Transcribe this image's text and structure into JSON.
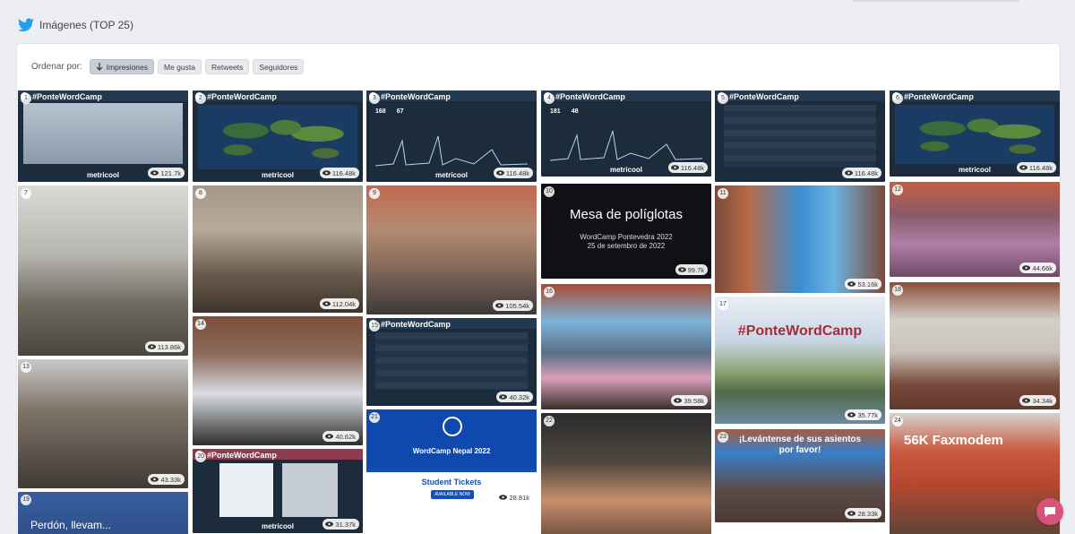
{
  "header": {
    "title": "Imágenes (TOP 25)",
    "icon": "twitter-icon"
  },
  "sort": {
    "label": "Ordenar por:",
    "options": [
      "Impresiones",
      "Me gusta",
      "Retweets",
      "Seguidores"
    ],
    "active": "Impresiones"
  },
  "brand_tag": "#PonteWordCamp",
  "brand_name": "metricool",
  "tiles": [
    {
      "num": "1",
      "views": "121.7k"
    },
    {
      "num": "2",
      "views": "116.48k"
    },
    {
      "num": "3",
      "views": "116.48k",
      "stats": [
        "168",
        "67"
      ]
    },
    {
      "num": "4",
      "views": "116.48k",
      "stats": [
        "181",
        "48"
      ]
    },
    {
      "num": "5",
      "views": "116.48k"
    },
    {
      "num": "6",
      "views": "116.48k"
    },
    {
      "num": "7",
      "views": "113.86k"
    },
    {
      "num": "8",
      "views": "112.04k"
    },
    {
      "num": "9",
      "views": "105.54k"
    },
    {
      "num": "10",
      "views": "99.7k",
      "title": "Mesa de políglotas",
      "sub1": "WordCamp Pontevedra 2022",
      "sub2": "25 de setembro de 2022"
    },
    {
      "num": "11",
      "views": "53.16k"
    },
    {
      "num": "12",
      "views": "44.66k"
    },
    {
      "num": "13",
      "views": "43.33k"
    },
    {
      "num": "14",
      "views": "40.62k"
    },
    {
      "num": "15",
      "views": "40.32k"
    },
    {
      "num": "16",
      "views": "39.58k"
    },
    {
      "num": "17",
      "views": "35.77k",
      "overlay": "#PonteWordCamp"
    },
    {
      "num": "18",
      "views": "34.34k"
    },
    {
      "num": "20",
      "views": "31.37k"
    },
    {
      "num": "21",
      "views": "28.81k",
      "title": "WordCamp Nepal 2022",
      "tickets": "Student Tickets",
      "button": "AVAILABLE NOW"
    },
    {
      "num": "22",
      "views": ""
    },
    {
      "num": "23",
      "views": "28.33k",
      "overlay": "¡Levántense de sus asientos por favor!"
    },
    {
      "num": "24",
      "views": "",
      "overlay": "56K Faxmodem"
    },
    {
      "num": "19",
      "views": "",
      "overlay": "Perdón, llevam..."
    }
  ],
  "colors": {
    "accent": "#1da1f2",
    "chat": "#d7537c",
    "panel": "#ffffff",
    "background": "#eceef1"
  }
}
